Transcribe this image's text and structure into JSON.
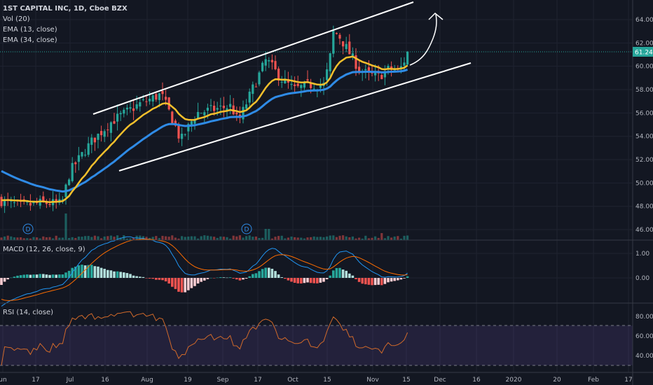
{
  "header": {
    "symbol_line": "1ST CAPITAL INC, 1D, Cboe BZX",
    "indicators": [
      "Vol (20)",
      "EMA (13, close)",
      "EMA (34, close)"
    ]
  },
  "macd_pane": {
    "label": "MACD (12, 26, close, 9)"
  },
  "rsi_pane": {
    "label": "RSI (14, close)"
  },
  "price_axis": {
    "labels": [
      "64.00",
      "62.00",
      "60.00",
      "58.00",
      "56.00",
      "54.00",
      "52.00",
      "50.00",
      "48.00",
      "46.00"
    ],
    "values": [
      64,
      62,
      60,
      58,
      56,
      54,
      52,
      50,
      48,
      46
    ]
  },
  "macd_axis": {
    "labels": [
      "1.00",
      "0.00"
    ],
    "values": [
      1,
      0
    ]
  },
  "rsi_axis": {
    "labels": [
      "80.00",
      "60.00",
      "40.00"
    ],
    "values": [
      80,
      60,
      40
    ],
    "upper_band": 70,
    "lower_band": 30
  },
  "last_price": {
    "label": "61.24",
    "value": 61.24
  },
  "time_axis": [
    "un",
    "17",
    "Jul",
    "16",
    "Aug",
    "19",
    "Sep",
    "17",
    "Oct",
    "15",
    "Nov",
    "15",
    "Dec",
    "16",
    "2020",
    "20",
    "Feb",
    "17"
  ],
  "dividend_marker": "D",
  "colors": {
    "up": "#26a69a",
    "down": "#ef5350",
    "ema13": "#f5c02c",
    "ema34": "#2f8be6",
    "macd": "#2196f3",
    "signal": "#ff6d00",
    "rsi": "#d26a2a",
    "background": "#131722"
  },
  "price_path_anchors": [
    [
      0,
      48.5
    ],
    [
      30,
      48
    ],
    [
      60,
      48.3
    ],
    [
      88,
      48.2
    ],
    [
      100,
      51
    ],
    [
      130,
      53.5
    ],
    [
      160,
      55.3
    ],
    [
      200,
      56.8
    ],
    [
      230,
      57.6
    ],
    [
      248,
      55.2
    ],
    [
      258,
      53.6
    ],
    [
      280,
      56
    ],
    [
      330,
      56.6
    ],
    [
      340,
      55.2
    ],
    [
      360,
      58
    ],
    [
      380,
      60.6
    ],
    [
      400,
      59
    ],
    [
      420,
      58
    ],
    [
      440,
      58.4
    ],
    [
      462,
      58.4
    ],
    [
      470,
      60.3
    ],
    [
      476,
      63
    ],
    [
      484,
      62.6
    ],
    [
      498,
      61.2
    ],
    [
      512,
      59.8
    ],
    [
      525,
      59.3
    ],
    [
      540,
      59.1
    ],
    [
      556,
      59.8
    ],
    [
      570,
      59.6
    ],
    [
      583,
      61.24
    ]
  ]
}
